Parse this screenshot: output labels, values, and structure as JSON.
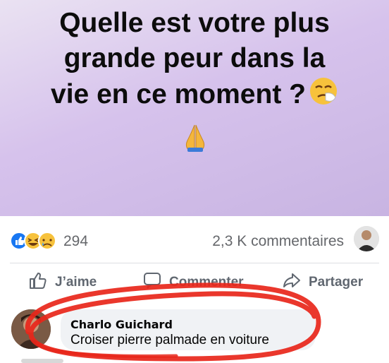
{
  "post": {
    "text_lines": [
      "Quelle est votre plus",
      "grande peur dans la",
      "vie en ce moment ?"
    ]
  },
  "stats": {
    "reaction_count": "294",
    "comments_count": "2,3 K commentaires",
    "reaction_icons": [
      "like-icon",
      "laugh-icon",
      "sad-icon"
    ]
  },
  "actions": {
    "like_label": "J’aime",
    "comment_label": "Commenter",
    "share_label": "Partager"
  },
  "comment": {
    "author": "Charlo Guichard",
    "text": "Croiser pierre palmade en voiture"
  },
  "colors": {
    "banner": "#d6c2ec",
    "annotation_red": "#e8261a",
    "facebook_blue": "#1877f2"
  }
}
